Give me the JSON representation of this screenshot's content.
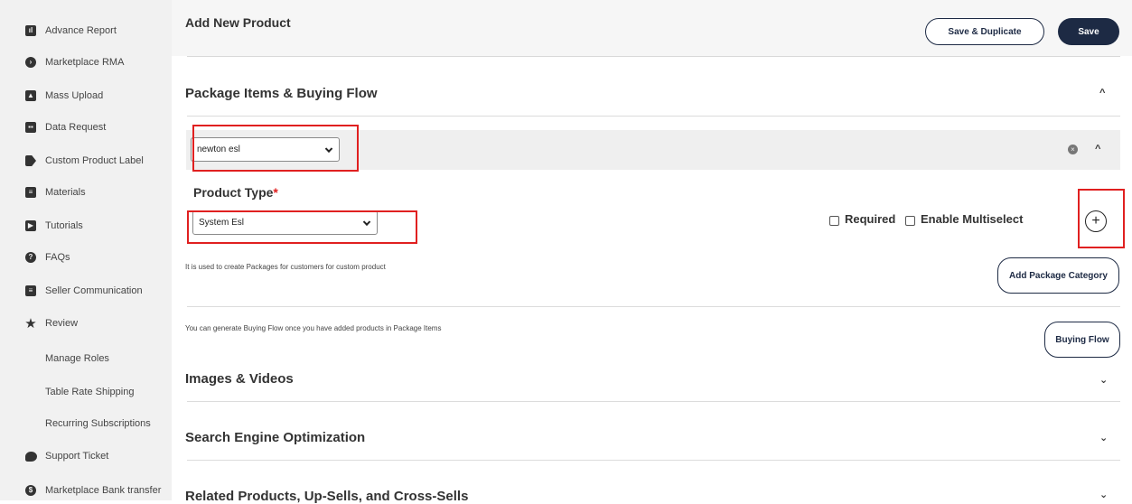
{
  "sidebar": {
    "items": [
      {
        "label": "Advance Report",
        "icon": "report-icon"
      },
      {
        "label": "Marketplace RMA",
        "icon": "rma-icon"
      },
      {
        "label": "Mass Upload",
        "icon": "upload-icon"
      },
      {
        "label": "Data Request",
        "icon": "data-icon"
      },
      {
        "label": "Custom Product Label",
        "icon": "tag-icon"
      },
      {
        "label": "Materials",
        "icon": "document-icon"
      },
      {
        "label": "Tutorials",
        "icon": "play-icon"
      },
      {
        "label": "FAQs",
        "icon": "help-icon"
      },
      {
        "label": "Seller Communication",
        "icon": "message-icon"
      },
      {
        "label": "Review",
        "icon": "star-icon"
      },
      {
        "label": "Manage Roles"
      },
      {
        "label": "Table Rate Shipping"
      },
      {
        "label": "Recurring Subscriptions"
      },
      {
        "label": "Support Ticket",
        "icon": "chat-icon"
      },
      {
        "label": "Marketplace Bank transfer",
        "icon": "bank-icon"
      }
    ]
  },
  "header": {
    "title": "Add New Product",
    "save_duplicate_label": "Save & Duplicate",
    "save_label": "Save"
  },
  "package_section": {
    "title": "Package Items & Buying Flow",
    "package_select_value": "newton esl",
    "product_type_label": "Product Type",
    "required_mark": "*",
    "product_type_value": "System Esl",
    "required_label": "Required",
    "multiselect_label": "Enable Multiselect",
    "add_symbol": "+",
    "hint_packages": "It is used to create Packages for customers for custom product",
    "add_package_category_label": "Add Package Category",
    "hint_buying_flow": "You can generate Buying Flow once you have added products in Package Items",
    "buying_flow_label": "Buying Flow"
  },
  "sections": {
    "images_videos": "Images & Videos",
    "seo": "Search Engine Optimization",
    "related": "Related Products, Up-Sells, and Cross-Sells"
  },
  "colors": {
    "accent": "#1d2a44",
    "highlight": "#e02020",
    "sidebar_bg": "#f1f1f1"
  }
}
